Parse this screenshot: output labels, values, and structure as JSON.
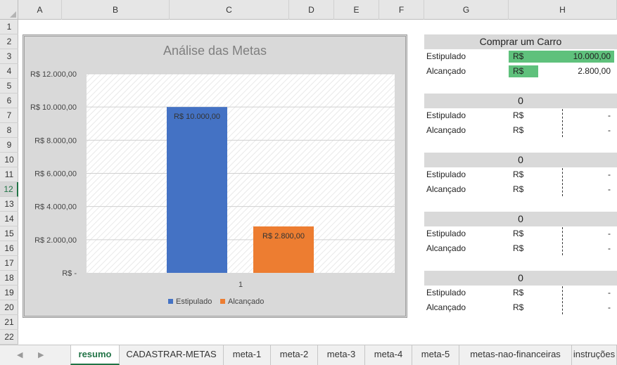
{
  "columns": [
    "A",
    "B",
    "C",
    "D",
    "E",
    "F",
    "G",
    "H"
  ],
  "rows": [
    "1",
    "2",
    "3",
    "4",
    "5",
    "6",
    "7",
    "8",
    "9",
    "10",
    "11",
    "12",
    "13",
    "14",
    "15",
    "16",
    "17",
    "18",
    "19",
    "20",
    "21",
    "22"
  ],
  "selected_row": "12",
  "chart_data": {
    "type": "bar",
    "title": "Análise das Metas",
    "categories": [
      "1"
    ],
    "series": [
      {
        "name": "Estipulado",
        "values": [
          10000
        ],
        "color": "#4472c4",
        "label": "R$ 10.000,00"
      },
      {
        "name": "Alcançado",
        "values": [
          2800
        ],
        "color": "#ed7d31",
        "label": "R$ 2.800,00"
      }
    ],
    "ylim": [
      0,
      12000
    ],
    "yticks": [
      0,
      2000,
      4000,
      6000,
      8000,
      10000,
      12000
    ],
    "ytick_labels": [
      "R$ -",
      "R$ 2.000,00",
      "R$ 4.000,00",
      "R$ 6.000,00",
      "R$ 8.000,00",
      "R$ 10.000,00",
      "R$ 12.000,00"
    ],
    "grid": true,
    "legend": "bottom"
  },
  "goals": [
    {
      "title": "Comprar um Carro",
      "planned_label": "Estipulado",
      "achieved_label": "Alcançado",
      "currency": "R$",
      "planned": "10.000,00",
      "achieved": "2.800,00",
      "planned_fraction": 1.0,
      "achieved_fraction": 0.28
    },
    {
      "title": "0",
      "planned_label": "Estipulado",
      "achieved_label": "Alcançado",
      "currency": "R$",
      "planned": "-",
      "achieved": "-"
    },
    {
      "title": "0",
      "planned_label": "Estipulado",
      "achieved_label": "Alcançado",
      "currency": "R$",
      "planned": "-",
      "achieved": "-"
    },
    {
      "title": "0",
      "planned_label": "Estipulado",
      "achieved_label": "Alcançado",
      "currency": "R$",
      "planned": "-",
      "achieved": "-"
    },
    {
      "title": "0",
      "planned_label": "Estipulado",
      "achieved_label": "Alcançado",
      "currency": "R$",
      "planned": "-",
      "achieved": "-"
    }
  ],
  "colors": {
    "accent": "#217346",
    "databar": "#5fc17c",
    "band": "#d9d9d9"
  },
  "sheet_tabs": [
    "resumo",
    "CADASTRAR-METAS",
    "meta-1",
    "meta-2",
    "meta-3",
    "meta-4",
    "meta-5",
    "metas-nao-financeiras",
    "instruções"
  ],
  "active_tab": "resumo"
}
